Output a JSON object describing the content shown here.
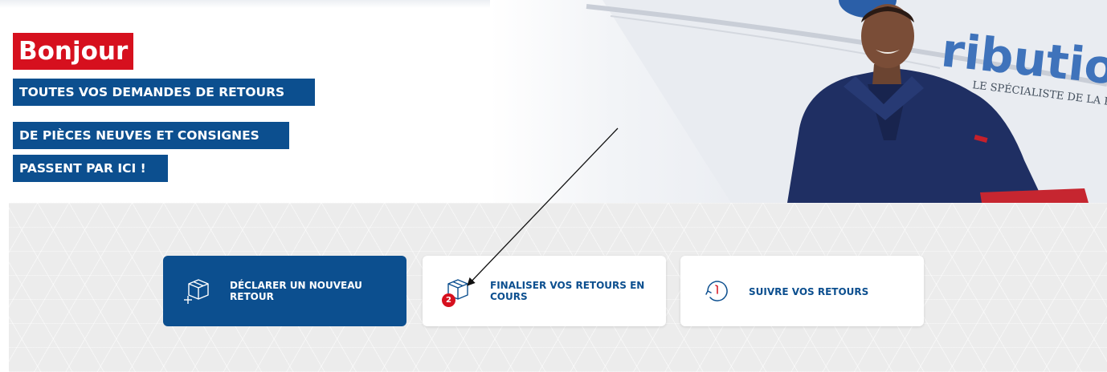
{
  "hero": {
    "greeting": "Bonjour",
    "tagline_lines": [
      "TOUTES VOS DEMANDES DE RETOURS",
      "DE PIÈCES NEUVES ET CONSIGNES",
      "PASSENT PAR ICI !"
    ],
    "van_logo_text": "ributio",
    "van_slogan_text": "LE SPÉCIALISTE DE LA PIÈ"
  },
  "actions": [
    {
      "label": "DÉCLARER UN NOUVEAU RETOUR",
      "icon": "box-plus-icon"
    },
    {
      "label": "FINALISER VOS RETOURS EN COURS",
      "icon": "box-icon",
      "badge": "2"
    },
    {
      "label": "SUIVRE VOS RETOURS",
      "icon": "history-clock-icon"
    }
  ],
  "colors": {
    "brand_blue": "#0c4f8f",
    "brand_red": "#d6101e",
    "background_pattern": "#ececec"
  }
}
